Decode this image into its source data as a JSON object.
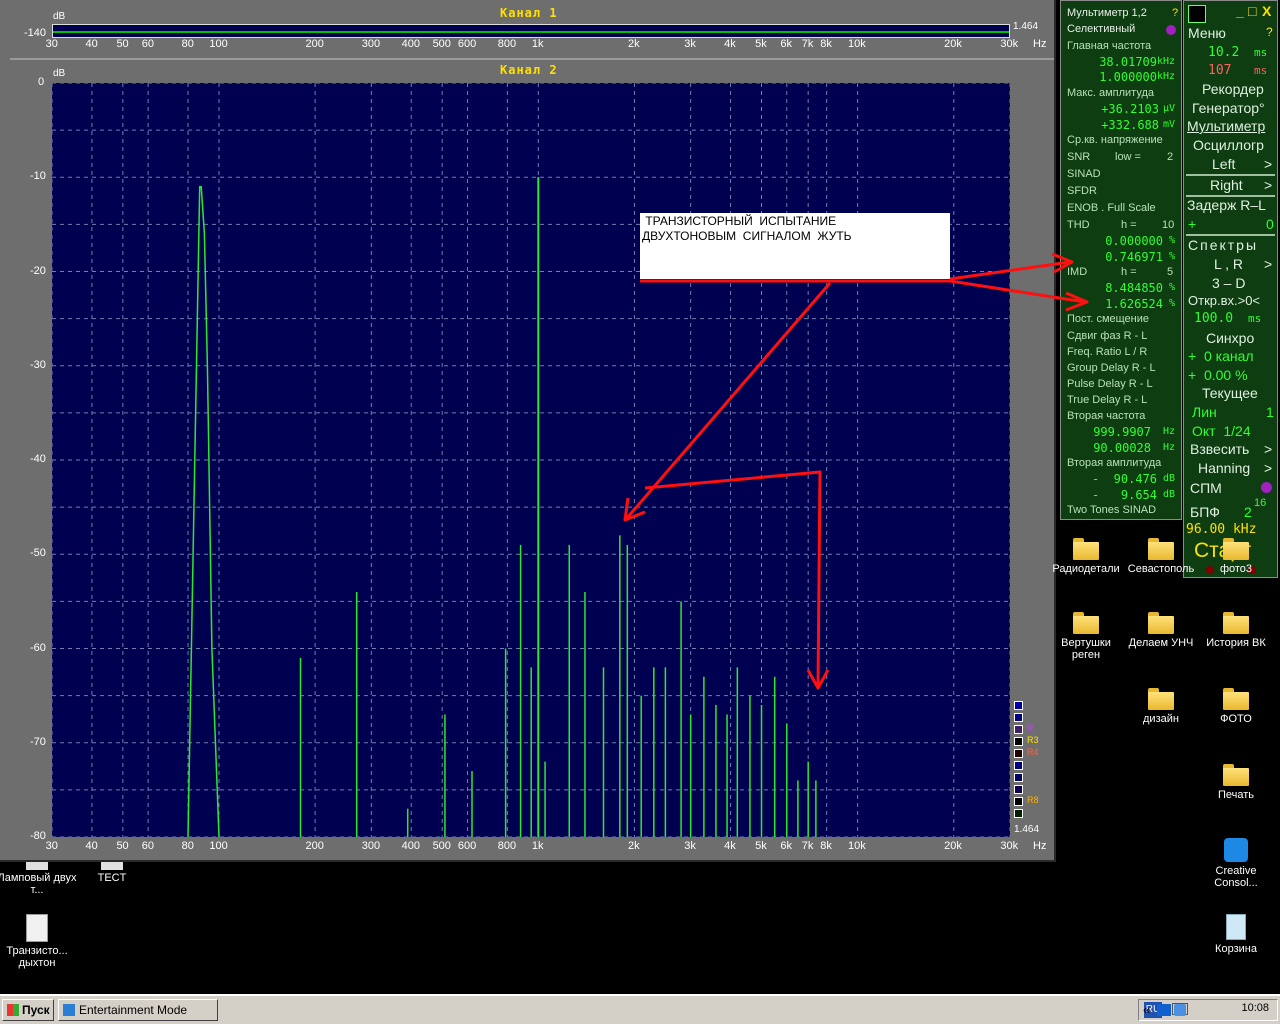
{
  "analyzer": {
    "channel1_title": "Канал 1",
    "channel2_title": "Канал 2",
    "db_unit": "dB",
    "ch1_top_value": "-140",
    "ch1_scale_value": "1.464",
    "ch2_scale_value": "1.464",
    "hz_unit": "Hz",
    "freq_ticks": [
      "30",
      "40",
      "50",
      "60",
      "80",
      "100",
      "200",
      "300",
      "400",
      "500",
      "600",
      "800",
      "1k",
      "2k",
      "3k",
      "4k",
      "5k",
      "6k",
      "7k",
      "8k",
      "10k",
      "20k",
      "30k"
    ],
    "db_ticks": [
      "0",
      "-10",
      "-20",
      "-30",
      "-40",
      "-50",
      "-60",
      "-70",
      "-80"
    ],
    "marker_labels": [
      "R3",
      "R4",
      "R8"
    ]
  },
  "chart_data": {
    "type": "line",
    "title": "Канал 2",
    "xlabel": "Hz",
    "ylabel": "dB",
    "x_scale": "log",
    "xlim": [
      30,
      30000
    ],
    "ylim": [
      -80,
      0
    ],
    "grid": true,
    "series": [
      {
        "x": [
          80,
          87,
          88,
          90,
          92,
          95,
          100,
          180,
          270,
          390,
          510,
          620,
          790,
          880,
          950,
          1000,
          1050,
          1250,
          1400,
          1600,
          1800,
          1900,
          2100,
          2300,
          2500,
          2800,
          3000,
          3300,
          3600,
          3900,
          4200,
          4600,
          5000,
          5500,
          6000,
          6500,
          7000,
          7400
        ],
        "values": [
          -80,
          -11,
          -11,
          -16,
          -30,
          -60,
          -80,
          -61,
          -54,
          -77,
          -67,
          -73,
          -60,
          -49,
          -62,
          -10,
          -72,
          -49,
          -54,
          -62,
          -48,
          -49,
          -65,
          -62,
          -62,
          -55,
          -67,
          -63,
          -66,
          -67,
          -62,
          -65,
          -66,
          -63,
          -68,
          -74,
          -72,
          -74
        ]
      }
    ]
  },
  "multimeter": {
    "title": "Мультиметр 1,2",
    "help": "?",
    "mode": "Селективный",
    "main_freq_label": "Главная частота",
    "main_freq_1": "38.01709",
    "main_freq_2": "1.000000",
    "freq_unit": "kHz",
    "max_amp_label": "Макс. амплитуда",
    "max_amp_1": "+36.2103",
    "max_amp_1_unit": "µV",
    "max_amp_2": "+332.688",
    "max_amp_2_unit": "mV",
    "rms_label": "Ср.кв. напряжение",
    "snr_label": "SNR",
    "snr_low": "low =",
    "snr_low_val": "2",
    "sinad_label": "SINAD",
    "sfdr_label": "SFDR",
    "enob_label": "ENOB . Full Scale",
    "thd_label": "THD",
    "thd_h": "h =",
    "thd_h_val": "10",
    "thd_1": "0.000000",
    "thd_2": "0.746971",
    "pct": "%",
    "imd_label": "IMD",
    "imd_h": "h =",
    "imd_h_val": "5",
    "imd_1": "8.484850",
    "imd_2": "1.626524",
    "dc_label": "Пост. смещение",
    "phase_label": "Сдвиг фаз R - L",
    "ratio_label": "Freq. Ratio  L / R",
    "group_label": "Group Delay R - L",
    "pulse_label": "Pulse Delay R - L",
    "true_label": "True Delay R - L",
    "second_freq_label": "Вторая частота",
    "second_freq_1": "999.9907",
    "second_freq_2": "90.00028",
    "hz": "Hz",
    "second_amp_label": "Вторая амплитуда",
    "second_amp_1": "-  90.476",
    "second_amp_2": "-   9.654",
    "db": "dB",
    "two_tones_label": "Two Tones SINAD"
  },
  "control": {
    "min_btn": "_",
    "max_btn": "□",
    "close_btn": "X",
    "menu": "Меню",
    "help": "?",
    "t1": "10.2",
    "t1_unit": "ms",
    "t2": "107",
    "t2_unit": "ms",
    "recorder": "Рекордер",
    "generator": "Генератор°",
    "multimeter": "Мультиметр",
    "oscillo": "Осциллогр",
    "left": "Left",
    "right": "Right",
    "gt": ">",
    "delay": "Задерж R–L",
    "plus": "+",
    "zero": "0",
    "spectra": "Спектры",
    "lr": "L , R",
    "three_d": "3 – D",
    "open_in": "Откр.вх.>0<",
    "open_in_val": "100.0",
    "open_in_unit": "ms",
    "sync": "Синхро",
    "sync_ch": "+  0 канал",
    "sync_pct": "+  0.00 %",
    "current": "Текущее",
    "lin": "Лин",
    "lin_val": "1",
    "oct": "Окт  1/24",
    "weigh": "Взвесить",
    "window": "Hanning",
    "spm": "СПМ",
    "fft": "БПФ",
    "fft_base": "2",
    "fft_exp": "16",
    "rate": "96.00 kHz",
    "start": "Старт"
  },
  "annotation": {
    "line1": " ТРАНЗИСТОРНЫЙ  ИСПЫТАНИЕ",
    "line2": "ДВУХТОНОВЫМ  СИГНАЛОМ  ЖУТЬ"
  },
  "desktop": {
    "icons_right": [
      {
        "label": "Радиодетали"
      },
      {
        "label": "Севастополь"
      },
      {
        "label": "фото3"
      },
      {
        "label": "Вертушки реген"
      },
      {
        "label": "Делаем УНЧ"
      },
      {
        "label": "История ВК"
      },
      {
        "label": "дизайн"
      },
      {
        "label": "ФОТО"
      },
      {
        "label": "Печать"
      },
      {
        "label": "Creative Consol..."
      },
      {
        "label": "Корзина"
      }
    ],
    "icons_left": [
      {
        "label": "Ламповый двух т..."
      },
      {
        "label": "TECT"
      },
      {
        "label": "Транзисто... дыхтон"
      }
    ]
  },
  "taskbar": {
    "start": "Пуск",
    "task": "Entertainment Mode",
    "lang": "RU",
    "chevron": "«",
    "time": "10:08"
  }
}
